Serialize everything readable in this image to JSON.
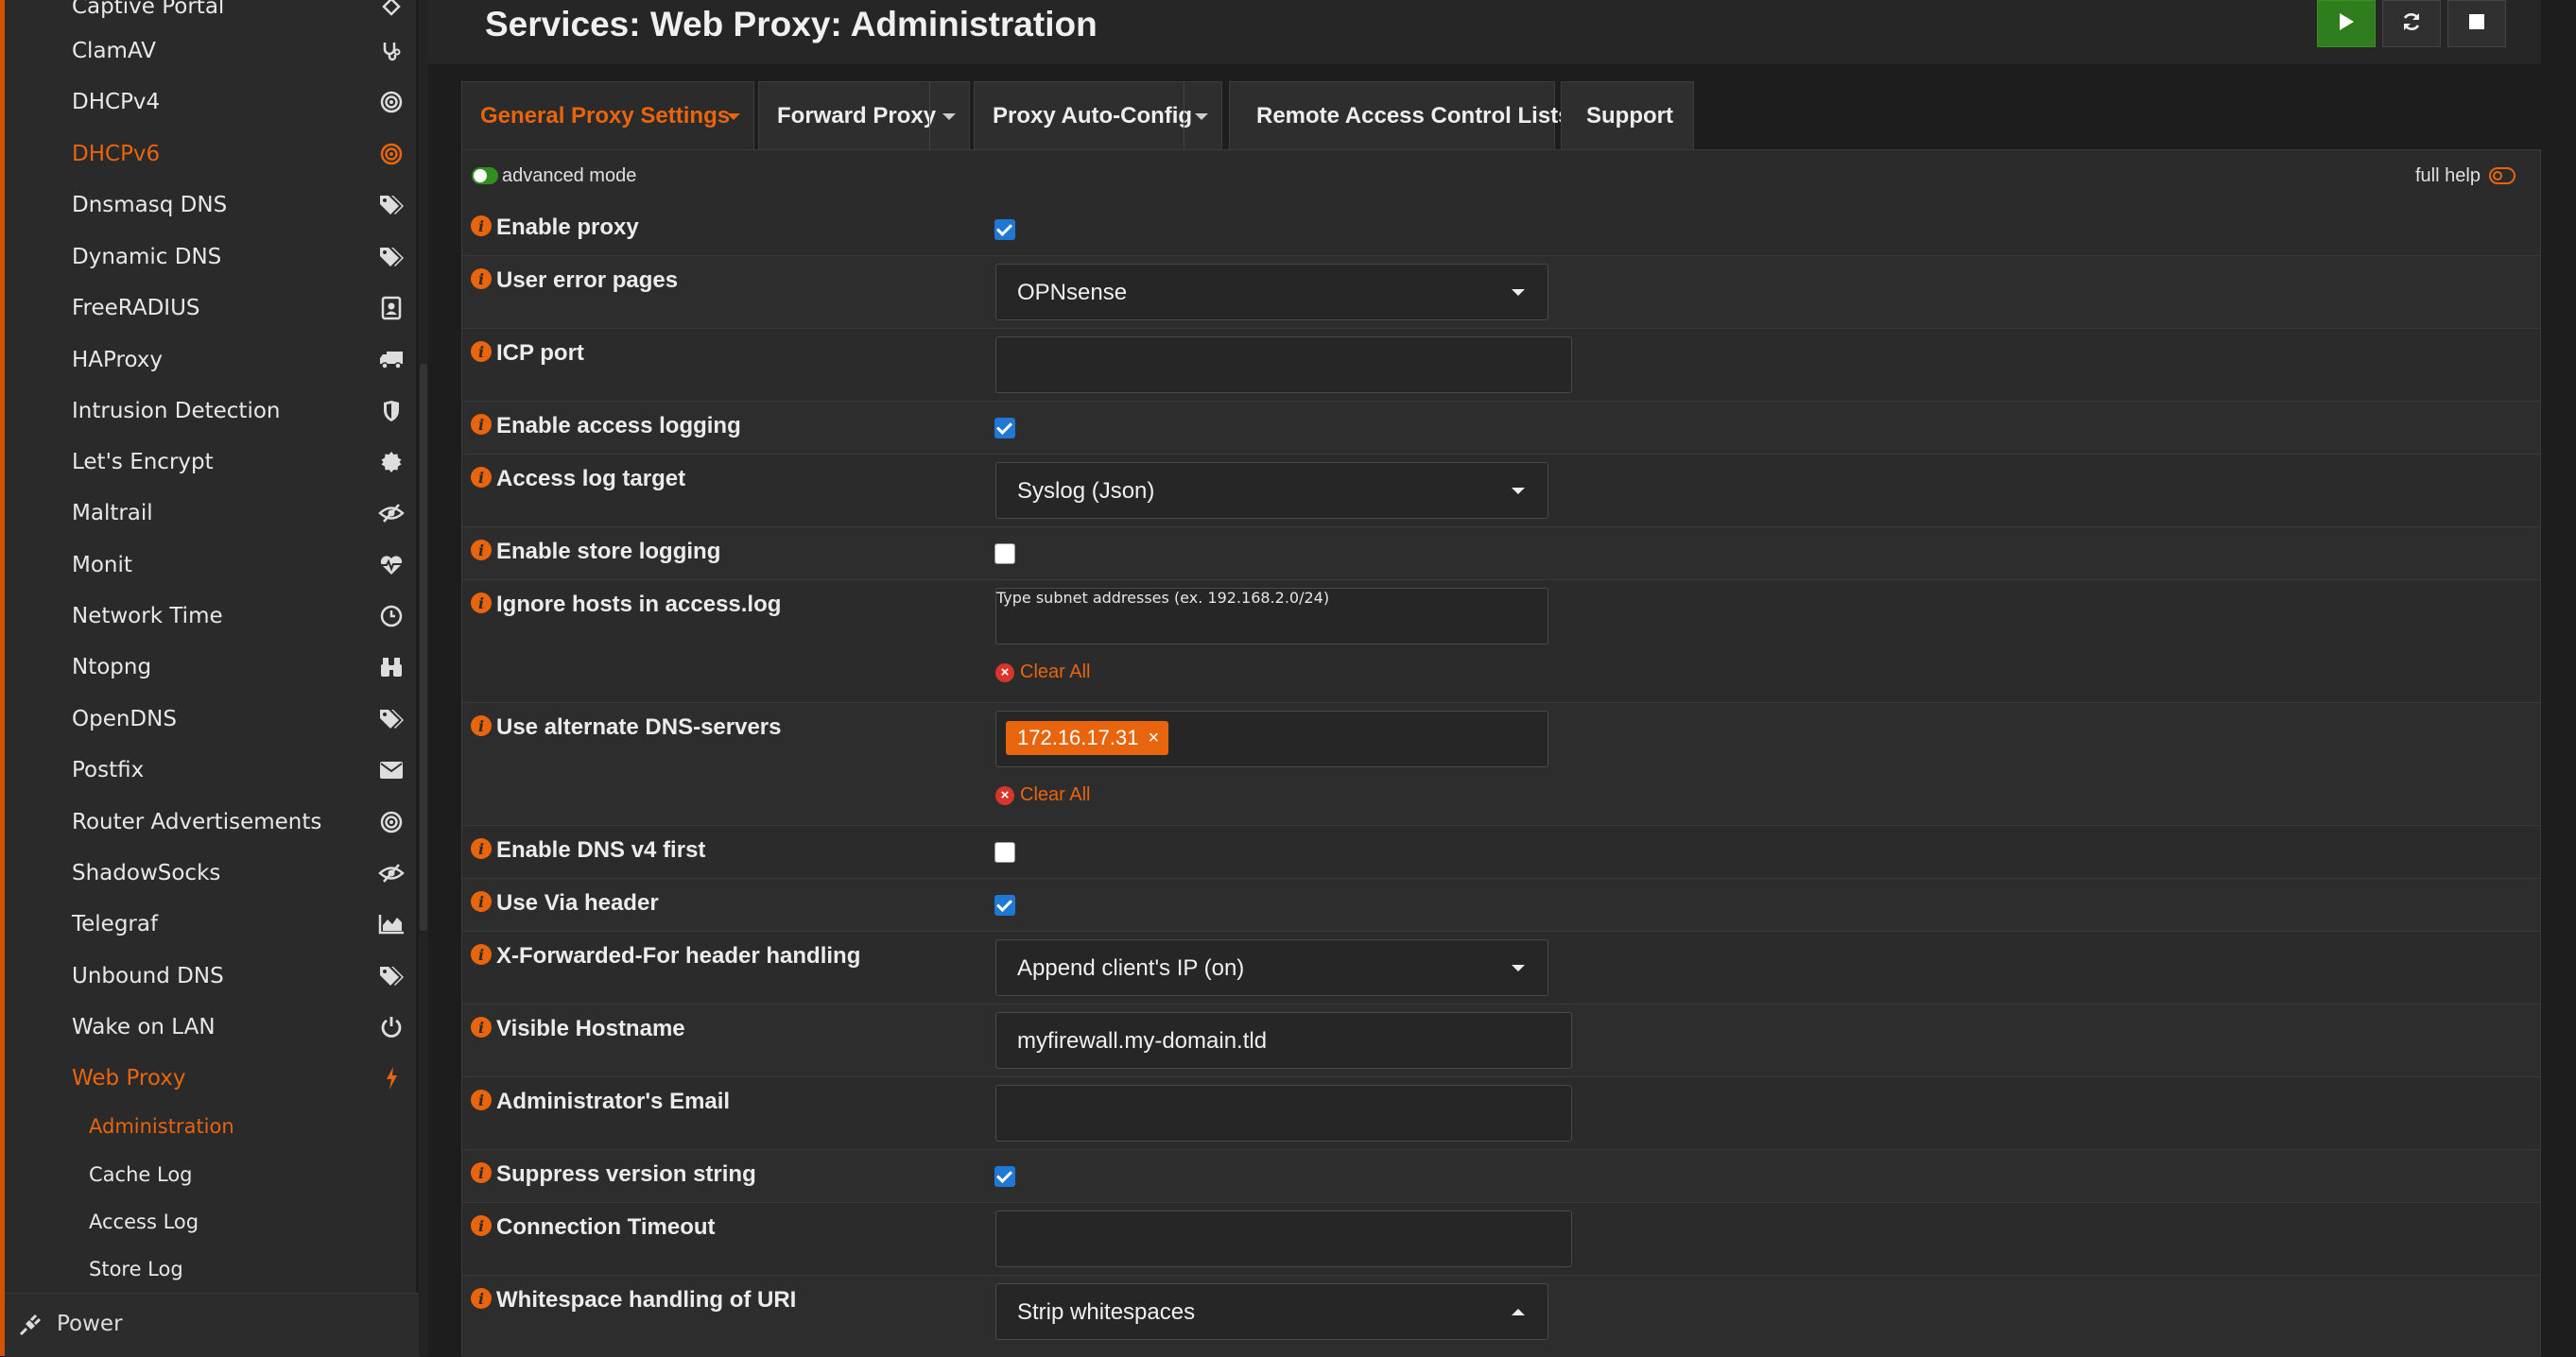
{
  "sidebar": {
    "items": [
      {
        "label": "Captive Portal",
        "icon": "captive-portal-icon"
      },
      {
        "label": "ClamAV",
        "icon": "stethoscope-icon"
      },
      {
        "label": "DHCPv4",
        "icon": "bullseye-icon"
      },
      {
        "label": "DHCPv6",
        "icon": "bullseye-icon"
      },
      {
        "label": "Dnsmasq DNS",
        "icon": "tags-icon"
      },
      {
        "label": "Dynamic DNS",
        "icon": "tags-icon"
      },
      {
        "label": "FreeRADIUS",
        "icon": "id-badge-icon"
      },
      {
        "label": "HAProxy",
        "icon": "truck-icon"
      },
      {
        "label": "Intrusion Detection",
        "icon": "shield-icon"
      },
      {
        "label": "Let's Encrypt",
        "icon": "certificate-icon"
      },
      {
        "label": "Maltrail",
        "icon": "eye-slash-icon"
      },
      {
        "label": "Monit",
        "icon": "heartbeat-icon"
      },
      {
        "label": "Network Time",
        "icon": "clock-icon"
      },
      {
        "label": "Ntopng",
        "icon": "binoculars-icon"
      },
      {
        "label": "OpenDNS",
        "icon": "tags-icon"
      },
      {
        "label": "Postfix",
        "icon": "envelope-icon"
      },
      {
        "label": "Router Advertisements",
        "icon": "bullseye-icon"
      },
      {
        "label": "ShadowSocks",
        "icon": "eye-slash-icon"
      },
      {
        "label": "Telegraf",
        "icon": "area-chart-icon"
      },
      {
        "label": "Unbound DNS",
        "icon": "tags-icon"
      },
      {
        "label": "Wake on LAN",
        "icon": "power-off-icon"
      },
      {
        "label": "Web Proxy",
        "icon": "bolt-icon"
      }
    ],
    "subitems": [
      {
        "label": "Administration"
      },
      {
        "label": "Cache Log"
      },
      {
        "label": "Access Log"
      },
      {
        "label": "Store Log"
      }
    ],
    "power_label": "Power"
  },
  "header": {
    "title": "Services: Web Proxy: Administration",
    "buttons": [
      "play-icon",
      "refresh-icon",
      "stop-icon"
    ]
  },
  "tabs": [
    {
      "label": "General Proxy Settings",
      "dropdown": true
    },
    {
      "label": "Forward Proxy",
      "dropdown": true
    },
    {
      "label": "Proxy Auto-Config",
      "dropdown": true
    },
    {
      "label": "Remote Access Control Lists",
      "dropdown": false
    },
    {
      "label": "Support",
      "dropdown": false
    }
  ],
  "modebar": {
    "advanced_label": "advanced mode",
    "full_help_label": "full help"
  },
  "form": {
    "enable_proxy": {
      "label": "Enable proxy",
      "checked": true
    },
    "user_error_pages": {
      "label": "User error pages",
      "value": "OPNsense"
    },
    "icp_port": {
      "label": "ICP port",
      "value": ""
    },
    "enable_access_logging": {
      "label": "Enable access logging",
      "checked": true
    },
    "access_log_target": {
      "label": "Access log target",
      "value": "Syslog (Json)"
    },
    "enable_store_logging": {
      "label": "Enable store logging",
      "checked": false
    },
    "ignore_hosts": {
      "label": "Ignore hosts in access.log",
      "placeholder": "Type subnet addresses (ex. 192.168.2.0/24)",
      "clear_label": "Clear All"
    },
    "alternate_dns": {
      "label": "Use alternate DNS-servers",
      "tag": "172.16.17.31",
      "tag_remove": "×",
      "clear_label": "Clear All"
    },
    "dns_v4_first": {
      "label": "Enable DNS v4 first",
      "checked": false
    },
    "via_header": {
      "label": "Use Via header",
      "checked": true
    },
    "xff_handling": {
      "label": "X-Forwarded-For header handling",
      "value": "Append client's IP (on)"
    },
    "visible_hostname": {
      "label": "Visible Hostname",
      "value": "myfirewall.my-domain.tld"
    },
    "admin_email": {
      "label": "Administrator's Email",
      "value": ""
    },
    "suppress_version": {
      "label": "Suppress version string",
      "checked": true
    },
    "connection_timeout": {
      "label": "Connection Timeout",
      "value": ""
    },
    "whitespace_handling": {
      "label": "Whitespace handling of URI",
      "value": "Strip whitespaces"
    }
  },
  "colors": {
    "accent": "#e8650d",
    "checkbox": "#1e78d4",
    "play": "#2f7d1c"
  }
}
